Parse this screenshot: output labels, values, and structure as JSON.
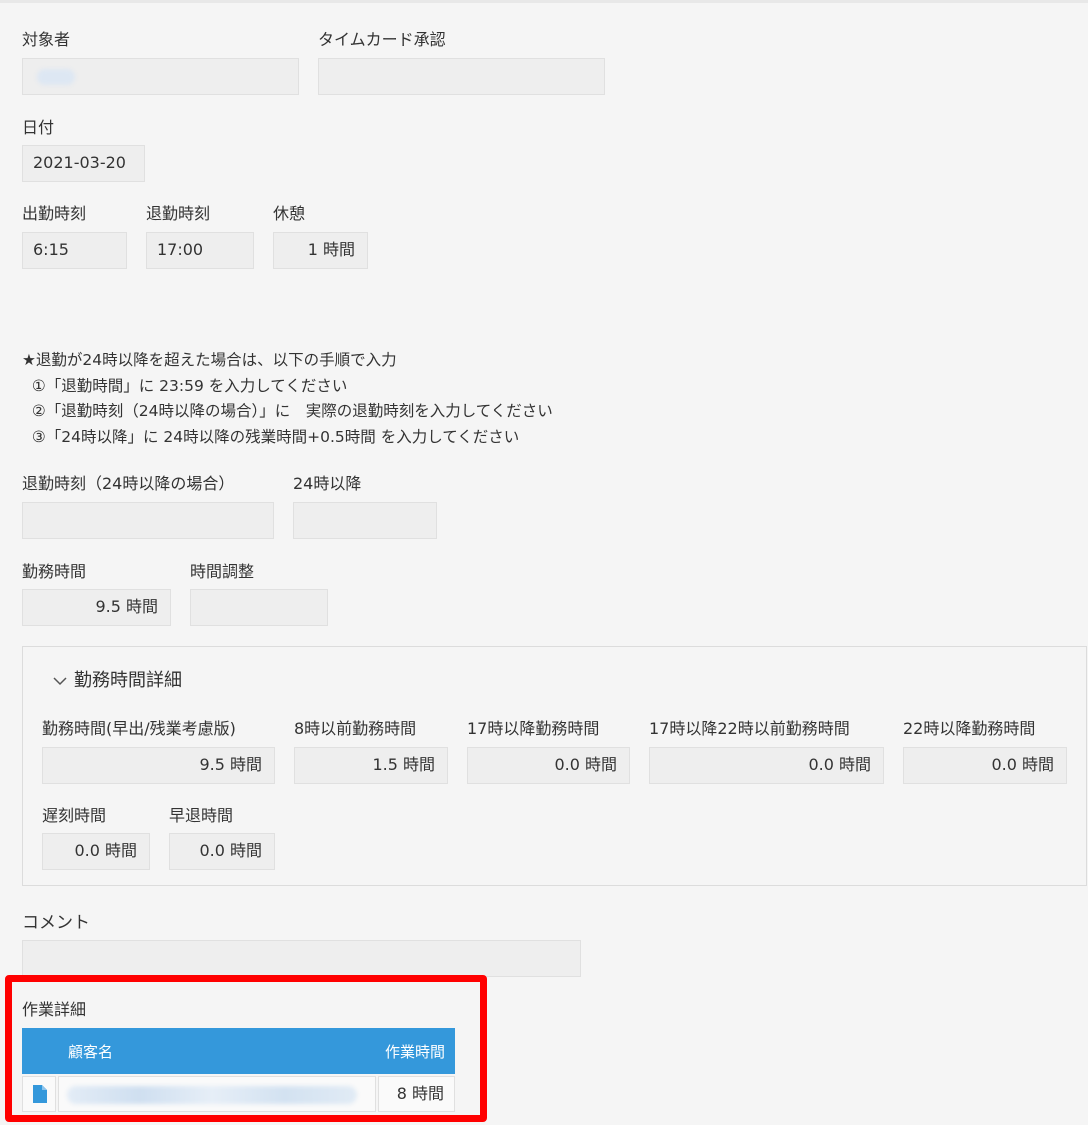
{
  "fields": {
    "target_label": "対象者",
    "target_value": "",
    "timecard_label": "タイムカード承認",
    "timecard_value": "",
    "date_label": "日付",
    "date_value": "2021-03-20",
    "clock_in_label": "出勤時刻",
    "clock_in_value": "6:15",
    "clock_out_label": "退勤時刻",
    "clock_out_value": "17:00",
    "break_label": "休憩",
    "break_value": "1 時間"
  },
  "note": {
    "line1": "★退勤が24時以降を超えた場合は、以下の手順で入力",
    "line2": "  ①「退勤時間」に 23:59 を入力してください",
    "line3": "  ②「退勤時刻（24時以降の場合）」に　実際の退勤時刻を入力してください",
    "line4": "  ③「24時以降」に 24時以降の残業時間+0.5時間 を入力してください"
  },
  "after24": {
    "clock_out_after24_label": "退勤時刻（24時以降の場合）",
    "clock_out_after24_value": "",
    "after24_label": "24時以降",
    "after24_value": ""
  },
  "work": {
    "work_hours_label": "勤務時間",
    "work_hours_value": "9.5 時間",
    "adjust_label": "時間調整",
    "adjust_value": ""
  },
  "detail": {
    "title": "勤務時間詳細",
    "items": [
      {
        "label": "勤務時間(早出/残業考慮版)",
        "value": "9.5 時間"
      },
      {
        "label": "8時以前勤務時間",
        "value": "1.5 時間"
      },
      {
        "label": "17時以降勤務時間",
        "value": "0.0 時間"
      },
      {
        "label": "17時以降22時以前勤務時間",
        "value": "0.0 時間"
      },
      {
        "label": "22時以降勤務時間",
        "value": "0.0 時間"
      },
      {
        "label": "遅刻時間",
        "value": "0.0 時間"
      },
      {
        "label": "早退時間",
        "value": "0.0 時間"
      }
    ]
  },
  "comment": {
    "label": "コメント",
    "value": ""
  },
  "work_detail": {
    "label": "作業詳細",
    "columns": [
      "顧客名",
      "作業時間"
    ],
    "rows": [
      {
        "customer": "",
        "hours": "8 時間"
      }
    ]
  },
  "colors": {
    "table_header": "#3498db",
    "highlight_frame": "#ff0000"
  }
}
